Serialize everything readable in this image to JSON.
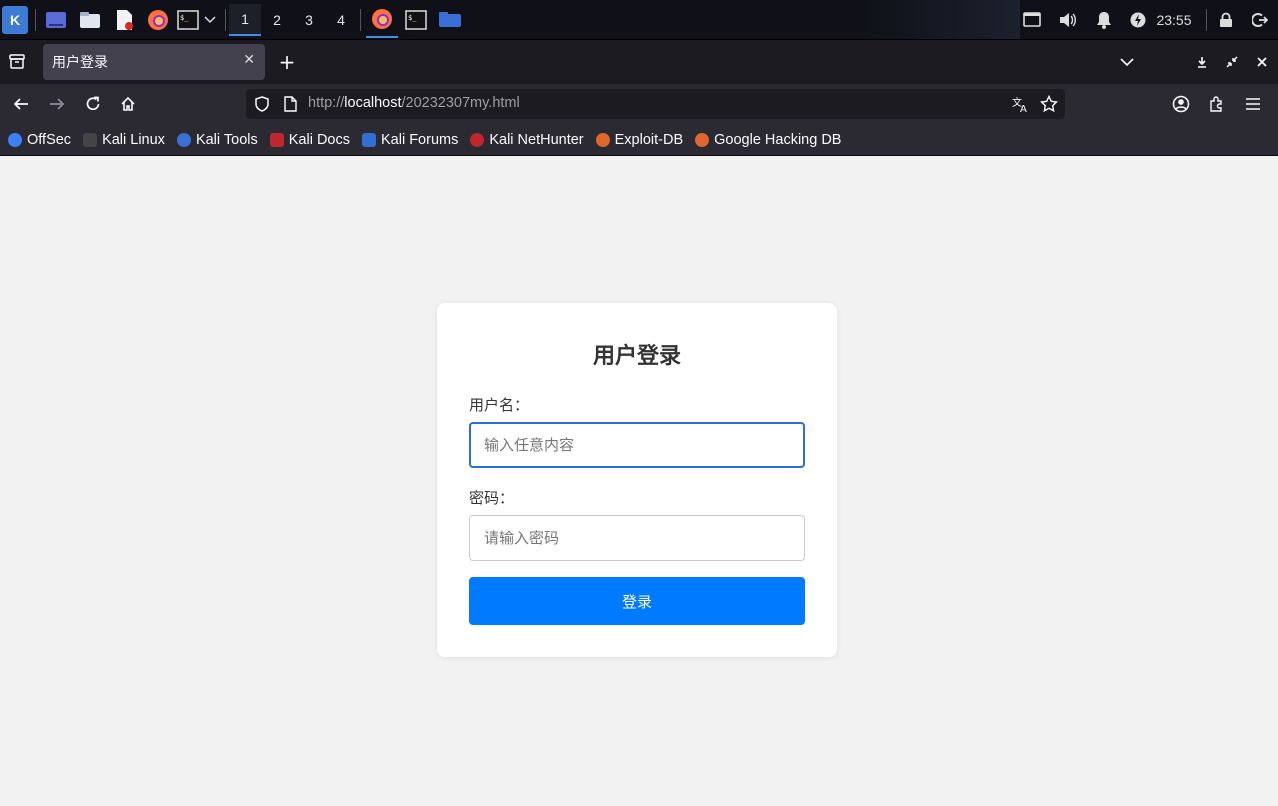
{
  "taskbar": {
    "workspaces": [
      "1",
      "2",
      "3",
      "4"
    ],
    "active_workspace": "1",
    "clock": "23:55"
  },
  "browser": {
    "tab_title": "用户登录",
    "url_prefix": "http://",
    "url_host": "localhost",
    "url_path": "/20232307my.html",
    "bookmarks": [
      {
        "label": "OffSec",
        "color": "#3b82f6"
      },
      {
        "label": "Kali Linux",
        "color": "#222222"
      },
      {
        "label": "Kali Tools",
        "color": "#3b6fd6"
      },
      {
        "label": "Kali Docs",
        "color": "#c0262d"
      },
      {
        "label": "Kali Forums",
        "color": "#2f6fd6"
      },
      {
        "label": "Kali NetHunter",
        "color": "#c0262d"
      },
      {
        "label": "Exploit-DB",
        "color": "#e0662b"
      },
      {
        "label": "Google Hacking DB",
        "color": "#e0662b"
      }
    ]
  },
  "login": {
    "title": "用户登录",
    "username_label": "用户名：",
    "username_placeholder": "输入任意内容",
    "password_label": "密码：",
    "password_placeholder": "请输入密码",
    "submit_label": "登录",
    "button_color": "#007bff"
  }
}
